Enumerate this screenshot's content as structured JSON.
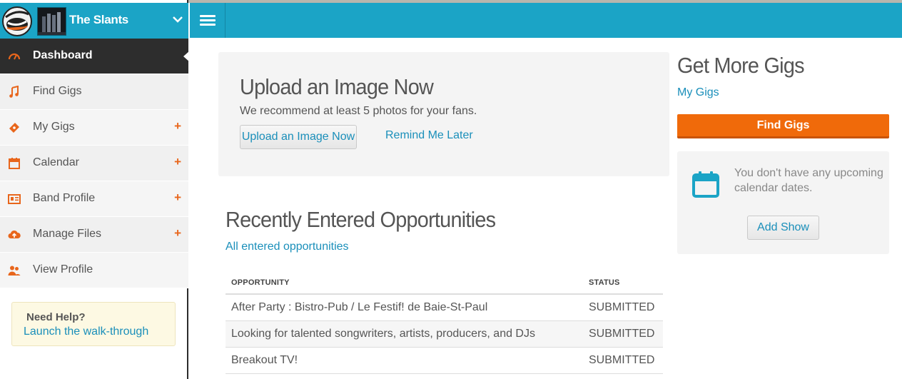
{
  "sidebar": {
    "band_name": "The Slants",
    "nav": [
      {
        "label": "Dashboard",
        "icon": "gauge-icon",
        "active": true,
        "expandable": false
      },
      {
        "label": "Find Gigs",
        "icon": "music-note-icon",
        "active": false,
        "expandable": false
      },
      {
        "label": "My Gigs",
        "icon": "ticket-icon",
        "active": false,
        "expandable": true
      },
      {
        "label": "Calendar",
        "icon": "calendar-icon",
        "active": false,
        "expandable": true
      },
      {
        "label": "Band Profile",
        "icon": "id-card-icon",
        "active": false,
        "expandable": true
      },
      {
        "label": "Manage Files",
        "icon": "cloud-upload-icon",
        "active": false,
        "expandable": true
      },
      {
        "label": "View Profile",
        "icon": "users-icon",
        "active": false,
        "expandable": false
      }
    ],
    "expand_symbol": "+",
    "help": {
      "title": "Need Help?",
      "link": "Launch the walk-through"
    }
  },
  "upload_panel": {
    "title": "Upload an Image Now",
    "subtitle": "We recommend at least 5 photos for your fans.",
    "button": "Upload an Image Now",
    "remind": "Remind Me Later"
  },
  "recent": {
    "title": "Recently Entered Opportunities",
    "link": "All entered opportunities",
    "columns": [
      "OPPORTUNITY",
      "STATUS"
    ],
    "rows": [
      {
        "opportunity": "After Party : Bistro-Pub / Le Festif! de Baie-St-Paul",
        "status": "SUBMITTED"
      },
      {
        "opportunity": "Looking for talented songwriters, artists, producers, and DJs",
        "status": "SUBMITTED"
      },
      {
        "opportunity": "Breakout TV!",
        "status": "SUBMITTED"
      }
    ]
  },
  "right": {
    "title": "Get More Gigs",
    "my_gigs_link": "My Gigs",
    "find_gigs_button": "Find Gigs",
    "calendar_text": "You don't have any upcoming calendar dates.",
    "add_show_button": "Add Show"
  },
  "colors": {
    "header": "#1ba4c6",
    "accent": "#f06a0a",
    "link": "#1a8fba",
    "sidebar_active": "#2d2d2d"
  }
}
